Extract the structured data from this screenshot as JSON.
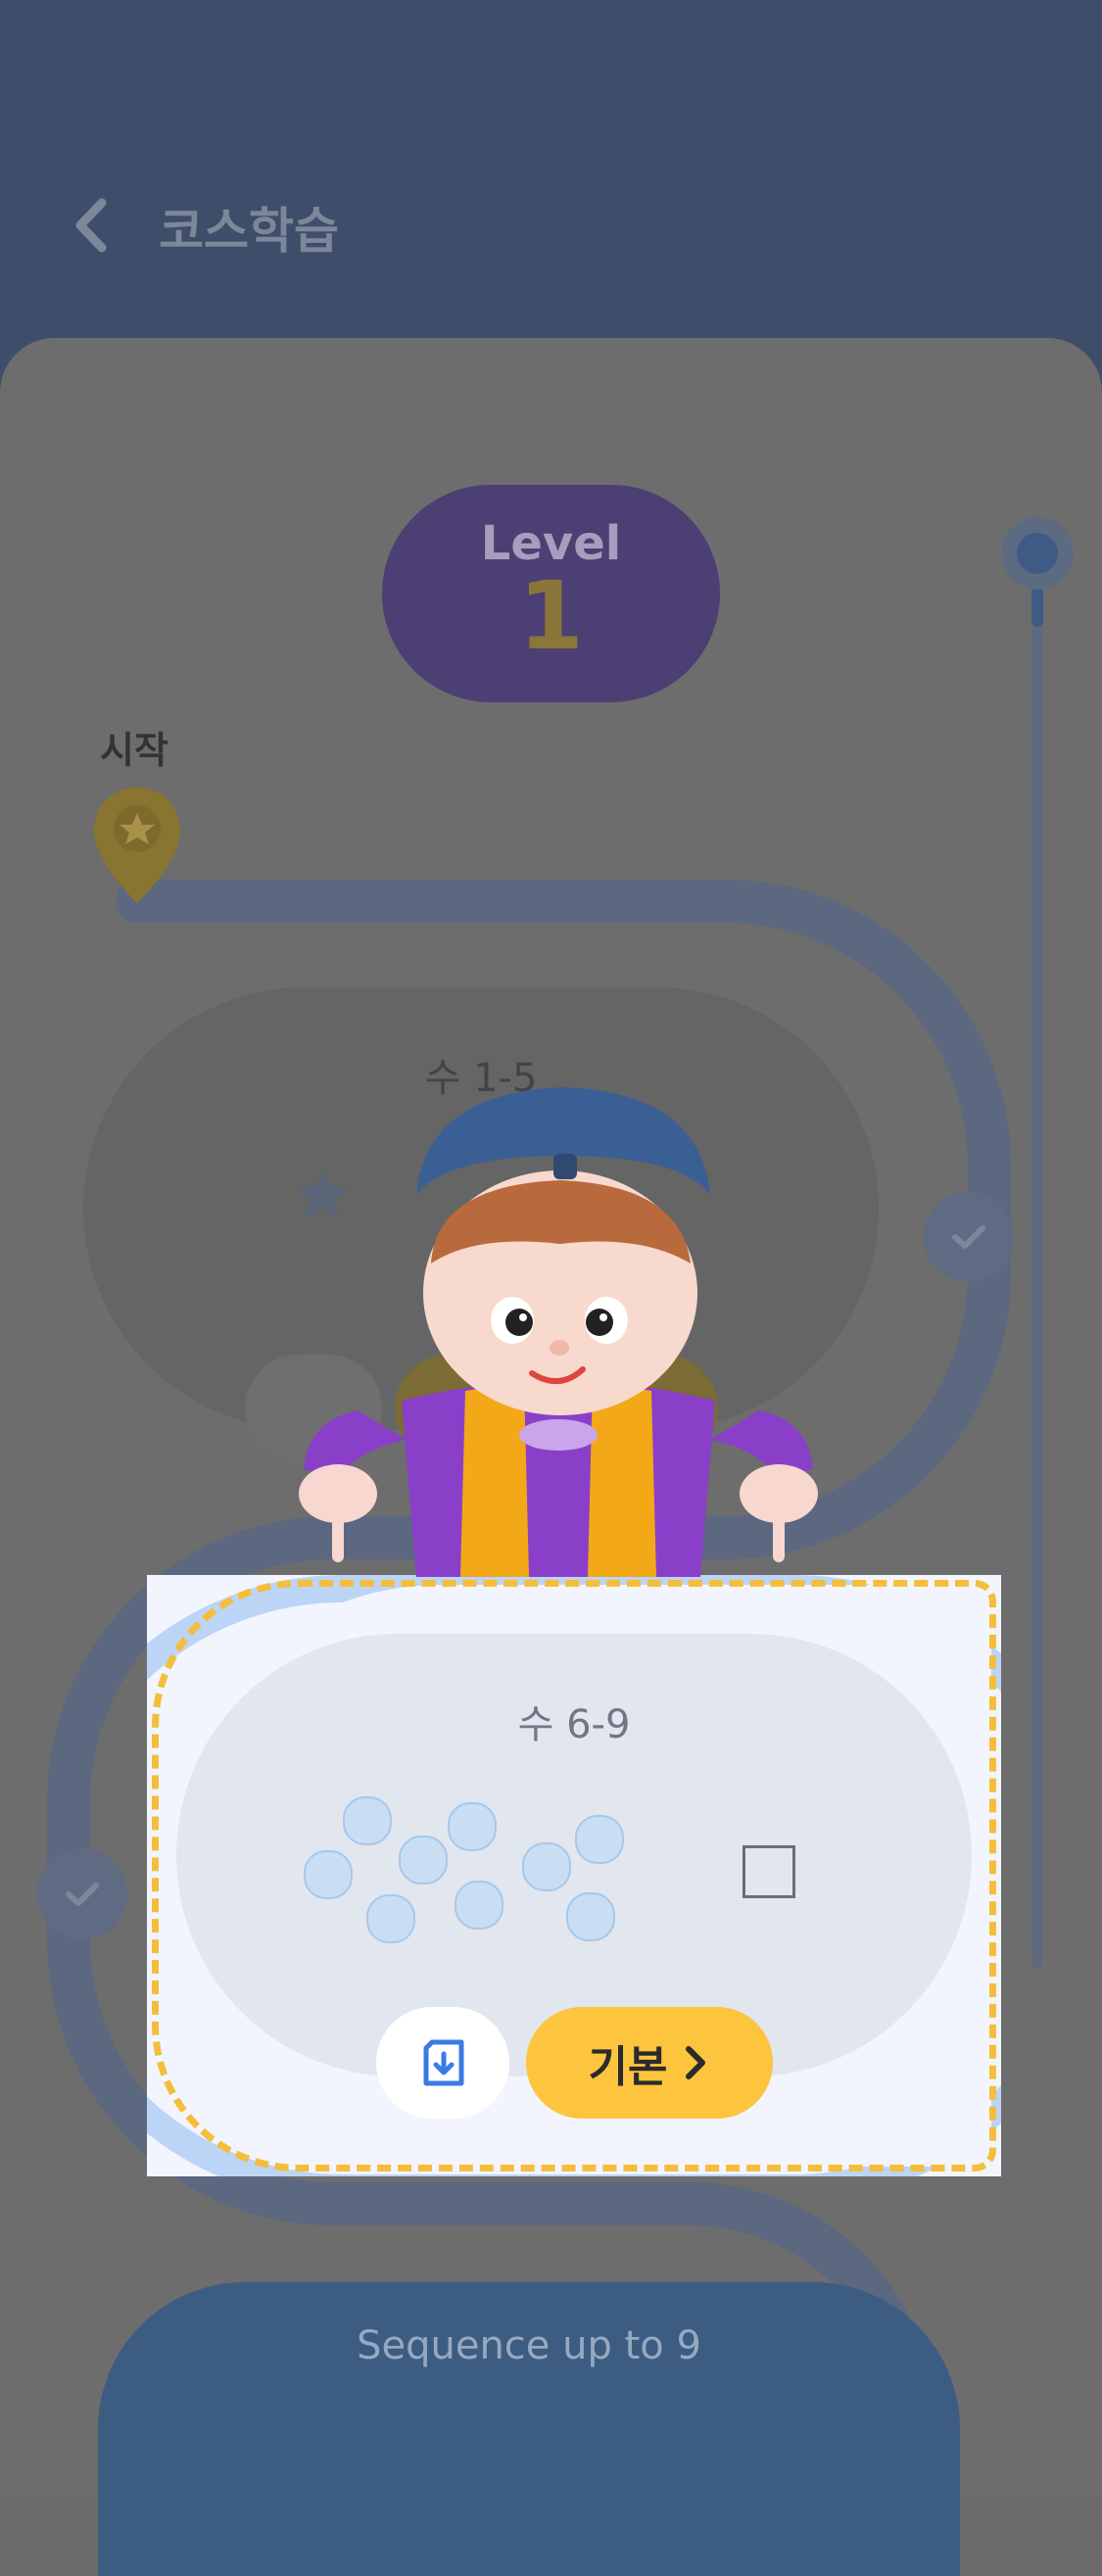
{
  "header": {
    "title": "코스학습"
  },
  "level": {
    "label": "Level",
    "number": "1"
  },
  "path": {
    "start_label": "시작"
  },
  "cards": [
    {
      "title": "수 1-5"
    },
    {
      "title": "수 6-9",
      "button_label": "기본"
    },
    {
      "title": "Sequence up to 9"
    }
  ],
  "colors": {
    "accent_yellow": "#fdc43e",
    "highlight_dash": "#f4bd3c",
    "header_bg": "#3e4e6a"
  }
}
